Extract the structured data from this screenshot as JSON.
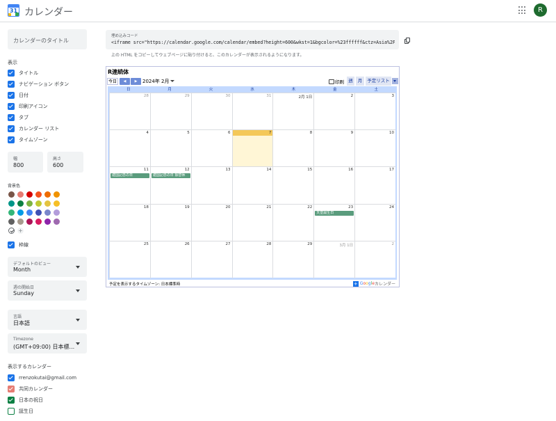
{
  "app": {
    "title": "カレンダー",
    "logo_num": "31",
    "avatar_initial": "R"
  },
  "sidebar": {
    "title_placeholder": "カレンダーのタイトル",
    "display_label": "表示",
    "display_options": [
      {
        "label": "タイトル",
        "checked": true
      },
      {
        "label": "ナビゲーション ボタン",
        "checked": true
      },
      {
        "label": "日付",
        "checked": true
      },
      {
        "label": "印刷アイコン",
        "checked": true
      },
      {
        "label": "タブ",
        "checked": true
      },
      {
        "label": "カレンダー リスト",
        "checked": true
      },
      {
        "label": "タイムゾーン",
        "checked": true
      }
    ],
    "width": {
      "label": "幅",
      "value": "800"
    },
    "height": {
      "label": "高さ",
      "value": "600"
    },
    "bg_label": "背景色",
    "bg_colors": [
      "#795548",
      "#e67c73",
      "#d50000",
      "#f4511e",
      "#ef6c00",
      "#f09300",
      "#009688",
      "#0b8043",
      "#7cb342",
      "#c0ca33",
      "#e4c441",
      "#f6bf26",
      "#33b679",
      "#039be5",
      "#4285f4",
      "#3f51b5",
      "#7986cb",
      "#b39ddb",
      "#616161",
      "#a79b8e",
      "#ad1457",
      "#d81b60",
      "#8e24aa",
      "#9e69af"
    ],
    "border": {
      "label": "枠線",
      "checked": true
    },
    "default_view": {
      "label": "デフォルトのビュー",
      "value": "Month"
    },
    "week_start": {
      "label": "週の開始日",
      "value": "Sunday"
    },
    "language": {
      "label": "言語",
      "value": "日本語"
    },
    "timezone": {
      "label": "Timezone",
      "value": "(GMT+09:00) 日本標..."
    },
    "calendars_label": "表示するカレンダー",
    "calendars": [
      {
        "label": "rrenzokutai@gmail.com",
        "color": "#1a73e8",
        "checked": true
      },
      {
        "label": "共同カレンダー",
        "color": "#e67c73",
        "checked": true
      },
      {
        "label": "日本の祝日",
        "color": "#0b8043",
        "checked": true
      },
      {
        "label": "誕生日",
        "color": "#0b8043",
        "checked": false
      }
    ]
  },
  "embed": {
    "label": "埋め込みコード",
    "code": "<iframe src=\"https://calendar.google.com/calendar/embed?height=600&wkst=1&bgcolor=%23ffffff&ctz=Asia%2FTokyo&sr",
    "helper": "上の HTML をコピーしてウェブページに貼り付けると、このカレンダーが表示されるようになります。"
  },
  "preview": {
    "cal_name": "R連続体",
    "today_btn": "今日",
    "prev": "◀",
    "next": "▶",
    "month": "2024年 2月",
    "print": "印刷",
    "tab_week": "週",
    "tab_month": "月",
    "tab_agenda": "予定リスト",
    "weekdays": [
      "日",
      "月",
      "火",
      "水",
      "木",
      "金",
      "土"
    ],
    "weeks": [
      [
        {
          "d": "28",
          "other": true
        },
        {
          "d": "29",
          "other": true
        },
        {
          "d": "30",
          "other": true
        },
        {
          "d": "31",
          "other": true
        },
        {
          "d": "2月 1日"
        },
        {
          "d": "2"
        },
        {
          "d": "3"
        }
      ],
      [
        {
          "d": "4"
        },
        {
          "d": "5"
        },
        {
          "d": "6"
        },
        {
          "d": "7",
          "today": true
        },
        {
          "d": "8"
        },
        {
          "d": "9"
        },
        {
          "d": "10"
        }
      ],
      [
        {
          "d": "11",
          "event": "建国記念の日"
        },
        {
          "d": "12",
          "event": "建国記念の日 振替休"
        },
        {
          "d": "13"
        },
        {
          "d": "14"
        },
        {
          "d": "15"
        },
        {
          "d": "16"
        },
        {
          "d": "17"
        }
      ],
      [
        {
          "d": "18"
        },
        {
          "d": "19"
        },
        {
          "d": "20"
        },
        {
          "d": "21"
        },
        {
          "d": "22"
        },
        {
          "d": "23",
          "event": "天皇誕生日"
        },
        {
          "d": "24"
        }
      ],
      [
        {
          "d": "25"
        },
        {
          "d": "26"
        },
        {
          "d": "27"
        },
        {
          "d": "28"
        },
        {
          "d": "29"
        },
        {
          "d": "3月 1日",
          "other": true
        },
        {
          "d": "2",
          "other": true
        }
      ]
    ],
    "tz_note": "予定を表示するタイムゾーン: 日本標準時",
    "badge_suffix": "カレンダー"
  }
}
